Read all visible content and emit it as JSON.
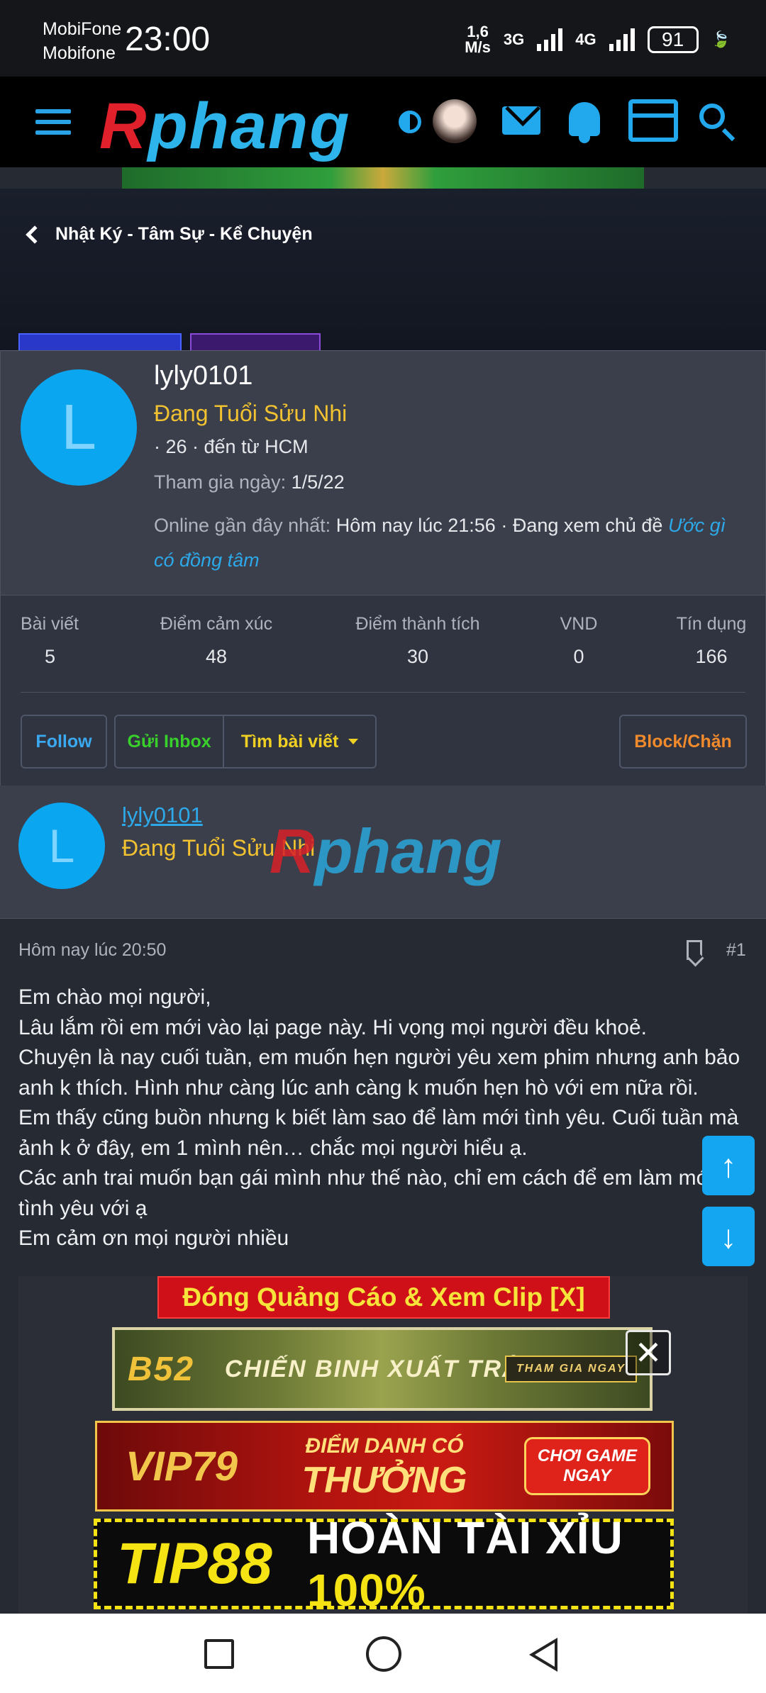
{
  "status_bar": {
    "carrier_1": "MobiFone",
    "carrier_2": "Mobifone",
    "time": "23:00",
    "speed_value": "1,6",
    "speed_unit": "M/s",
    "net_1": "3G",
    "net_2": "4G",
    "battery": "91"
  },
  "nav": {
    "logo_r": "R",
    "logo_rest": "phang"
  },
  "breadcrumb": {
    "label": "Nhật Ký - Tâm Sự - Kể Chuyện"
  },
  "profile_popup": {
    "avatar_letter": "L",
    "username": "lyly0101",
    "user_title": "Đang Tuổi Sửu Nhi",
    "meta": "· 26 · đến từ HCM",
    "joined_label": "Tham gia ngày:",
    "joined_value": "1/5/22",
    "online_label": "Online gần đây nhất:",
    "online_value": "Hôm nay lúc 21:56 · Đang xem chủ đề",
    "online_thread": "Ước gì có đồng tâm",
    "stats": [
      {
        "label": "Bài viết",
        "value": "5"
      },
      {
        "label": "Điểm cảm xúc",
        "value": "48"
      },
      {
        "label": "Điểm thành tích",
        "value": "30"
      },
      {
        "label": "VND",
        "value": "0"
      },
      {
        "label": "Tín dụng",
        "value": "166"
      }
    ],
    "buttons": {
      "follow": "Follow",
      "inbox": "Gửi Inbox",
      "find_posts": "Tìm bài viết",
      "block": "Block/Chặn"
    }
  },
  "post": {
    "author_letter": "L",
    "author_name": "lyly0101",
    "author_title": "Đang Tuổi Sửu Nhi",
    "date": "Hôm nay lúc 20:50",
    "number": "#1",
    "body": [
      "Em chào mọi người,",
      "Lâu lắm rồi em mới vào lại page này. Hi vọng mọi người đều khoẻ.",
      "Chuyện là nay cuối tuần, em muốn hẹn người yêu xem phim nhưng anh bảo anh k thích. Hình như càng lúc anh càng k muốn hẹn hò với em nữa rồi.",
      "Em thấy cũng buồn nhưng k biết làm sao để làm mới tình yêu. Cuối tuần mà ảnh k ở đây, em 1 mình nên… chắc mọi người hiểu ạ.",
      "Các anh trai muốn bạn gái mình như thế nào, chỉ em cách để em làm mới tình yêu với ạ",
      "Em cảm ơn mọi người nhiều"
    ]
  },
  "ads": {
    "close_label": "Đóng Quảng Cáo & Xem Clip [X]",
    "close_x": "✕",
    "ad1_brand": "B52",
    "ad1_text": "CHIẾN BINH XUẤT TRẬN",
    "ad1_cta": "THAM GIA NGAY",
    "ad2_brand": "VIP79",
    "ad2_line1": "ĐIỂM DANH CÓ",
    "ad2_line2": "THƯỞNG",
    "ad2_cta_1": "CHƠI GAME",
    "ad2_cta_2": "NGAY",
    "ad3_brand": "TIP88",
    "ad3_text": "HOÀN TÀI XỈU",
    "ad3_percent": "100%"
  },
  "scroll": {
    "up": "↑",
    "down": "↓"
  }
}
